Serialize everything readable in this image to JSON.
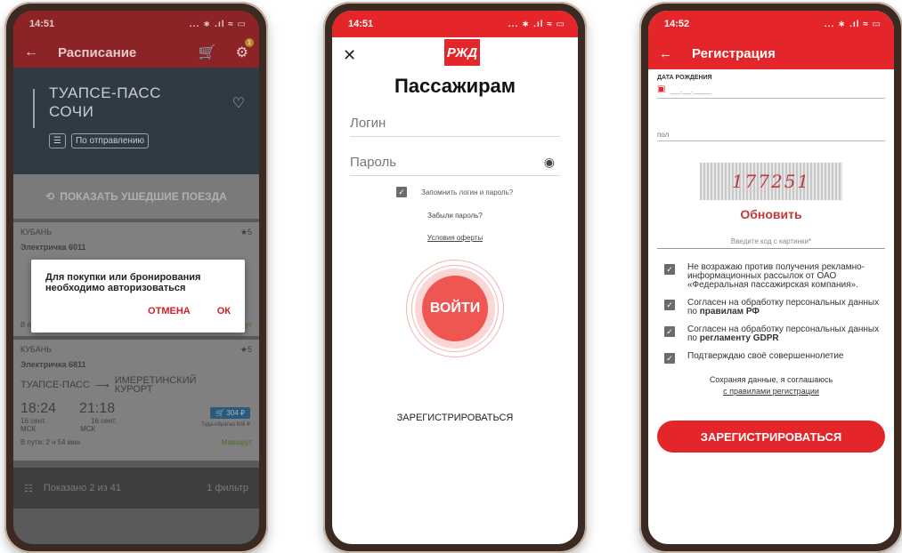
{
  "phone1": {
    "time": "14:51",
    "status_icons": "... ∗ .ıl ≈ ▭",
    "title": "Расписание",
    "badge": "1",
    "from": "ТУАПСЕ-ПАСС",
    "to": "СОЧИ",
    "sort": "По отправлению",
    "show_gone": "ПОКАЗАТЬ УШЕДШИЕ ПОЕЗДА",
    "card1": {
      "brand": "КУБАНЬ",
      "rating": "5",
      "train": "Электричка 6011",
      "bottom": "В пу",
      "route_label": "Маршрут"
    },
    "card2": {
      "brand": "КУБАНЬ",
      "rating": "5",
      "train": "Электричка 6811",
      "from": "ТУАПСЕ-ПАСС",
      "to": "ИМЕРЕТИНСКИЙ КУРОРТ",
      "dep": "18:24",
      "arr": "21:18",
      "dep_date": "16 сент.",
      "arr_date": "16 сент.",
      "dep_tz": "МСК",
      "arr_tz": "МСК",
      "price": "304 ₽",
      "roundtrip": "Туда-обратно 608 ₽",
      "duration": "В пути: 2 ч 54 мин",
      "route_label": "Маршрут"
    },
    "bottom": {
      "shown": "Показано 2 из 41",
      "filters": "1 фильтр"
    },
    "dialog": {
      "message": "Для покупки или бронирования необходимо авторизоваться",
      "cancel": "ОТМЕНА",
      "ok": "ОК"
    }
  },
  "phone2": {
    "time": "14:51",
    "status_icons": "... ∗ .ıl ≈ ▭",
    "logo": "РЖД",
    "title": "Пассажирам",
    "login_placeholder": "Логин",
    "password_placeholder": "Пароль",
    "remember": "Запомнить логин и пароль?",
    "forgot": "Забыли пароль?",
    "terms": "Условия оферты",
    "login_button": "ВОЙТИ",
    "register": "ЗАРЕГИСТРИРОВАТЬСЯ"
  },
  "phone3": {
    "time": "14:52",
    "status_icons": "... ∗ .ıl ≈ ▭",
    "title": "Регистрация",
    "birth_label": "ДАТА РОЖДЕНИЯ",
    "birth_value": "__.__.____",
    "sex_label": "пол",
    "captcha": "177251",
    "refresh": "Обновить",
    "code_placeholder": "Введите код с картинки*",
    "agree1": "Не возражаю против получения рекламно-информационных рассылок от ОАО «Федеральная пассажирская компания».",
    "agree2_prefix": "Согласен на обработку персональных данных по ",
    "agree2_bold": "правилам РФ",
    "agree3_prefix": "Согласен на обработку персональных данных по ",
    "agree3_bold": "регламенту GDPR",
    "agree4": "Подтверждаю своё совершеннолетие",
    "note_line1": "Сохраняя данные, я соглашаюсь",
    "note_link": "с правилами регистрации",
    "register_button": "ЗАРЕГИСТРИРОВАТЬСЯ"
  },
  "colors": {
    "brand_red": "#e4262a",
    "button_red": "#ef5652",
    "link_red": "#d32027"
  }
}
